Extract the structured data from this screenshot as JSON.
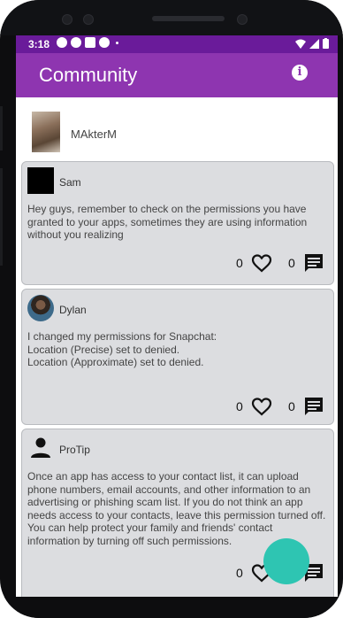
{
  "status": {
    "time": "3:18"
  },
  "appbar": {
    "title": "Community"
  },
  "current_user": {
    "name": "MAkterM"
  },
  "posts": [
    {
      "author": "Sam",
      "body": "Hey guys, remember to check on the permissions you have granted to your apps, sometimes they are using information without you realizing",
      "likes": "0",
      "comments": "0"
    },
    {
      "author": "Dylan",
      "body": "I changed my permissions for Snapchat:\nLocation (Precise) set to denied.\nLocation (Approximate) set to denied.",
      "likes": "0",
      "comments": "0"
    },
    {
      "author": "ProTip",
      "body": "Once an app has access to your contact list, it can upload phone numbers, email accounts, and other information to an advertising or phishing scam list. If you do not think an app needs access to your contacts, leave this permission turned off. You can help protect your family and friends' contact information by turning off such permissions.",
      "likes": "0",
      "comments": "0"
    }
  ],
  "colors": {
    "status_bar": "#6a1b9a",
    "app_bar": "#8e35b0",
    "card": "#dcdde0",
    "fab": "#2ec5b2"
  },
  "icons": [
    "info-icon",
    "heart-outline-icon",
    "comment-icon",
    "person-icon"
  ]
}
